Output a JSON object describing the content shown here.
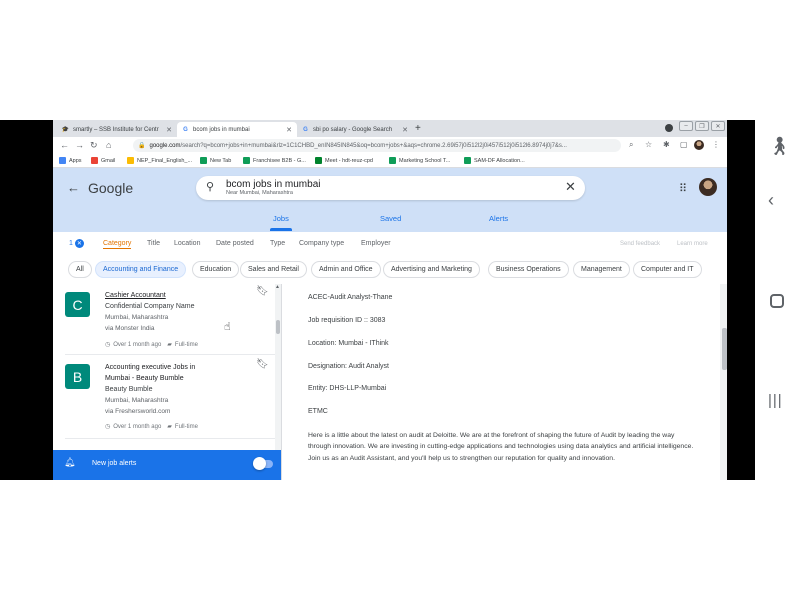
{
  "browser": {
    "tabs": [
      {
        "label": "smartly – SSB Institute for Centr",
        "icon": "graduation-cap-icon"
      },
      {
        "label": "bcom jobs in mumbai",
        "icon": "google-icon"
      },
      {
        "label": "sbi po salary - Google Search",
        "icon": "google-icon"
      }
    ],
    "new_tab_symbol": "+",
    "url_host": "google.com",
    "url_path": "/search?q=bcom+jobs+in+mumbai&rlz=1C1CHBD_enIN845IN845&oq=bcom+jobs+&aqs=chrome.2.69i57j0i512l2j0i457i512j0i512l6.8974j0j7&s...",
    "bookmarks": [
      {
        "label": "Apps",
        "color": "#4285f4"
      },
      {
        "label": "Gmail",
        "color": "#ea4335"
      },
      {
        "label": "NEP_Final_English_...",
        "color": "#fbbc04"
      },
      {
        "label": "New Tab",
        "color": "#0f9d58"
      },
      {
        "label": "Franchisee B2B - G...",
        "color": "#0f9d58"
      },
      {
        "label": "Meet - hdt-reuz-cpd",
        "color": "#00832d"
      },
      {
        "label": "Marketing School T...",
        "color": "#0f9d58"
      },
      {
        "label": "SAM-DF Allocation...",
        "color": "#0f9d58"
      }
    ]
  },
  "google": {
    "logo": "Google",
    "query": "bcom jobs in mumbai",
    "location": "Near Mumbai, Maharashtra",
    "tabs": [
      "Jobs",
      "Saved",
      "Alerts"
    ],
    "accent": "#1a73e8"
  },
  "filters": {
    "count": "1",
    "items": [
      "Category",
      "Title",
      "Location",
      "Date posted",
      "Type",
      "Company type",
      "Employer"
    ],
    "send_feedback": "Send feedback",
    "learn_more": "Learn more"
  },
  "chips": [
    "All",
    "Accounting and Finance",
    "Education",
    "Sales and Retail",
    "Admin and Office",
    "Advertising and Marketing",
    "Business Operations",
    "Management",
    "Computer and IT"
  ],
  "results": [
    {
      "logo_letter": "C",
      "title": "Cashier Accountant",
      "company": "Confidential Company Name",
      "location": "Mumbai, Maharashtra",
      "via": "via Monster India",
      "posted": "Over 1 month ago",
      "type": "Full-time"
    },
    {
      "logo_letter": "B",
      "title_lines": [
        "Accounting executive Jobs in",
        "Mumbai - Beauty Bumble"
      ],
      "company": "Beauty Bumble",
      "location": "Mumbai, Maharashtra",
      "via": "via Freshersworld.com",
      "posted": "Over 1 month ago",
      "type": "Full-time"
    }
  ],
  "alerts": {
    "label": "New job alerts"
  },
  "detail": {
    "lines": [
      "ACEC-Audit Analyst-Thane",
      "Job requisition ID :: 3083",
      "Location: Mumbai - IThink",
      "Designation: Audit Analyst",
      "Entity: DHS-LLP-Mumbai",
      "ETMC"
    ],
    "paragraph": "Here is a little about the latest on audit at Deloitte. We are at the forefront of shaping the future of Audit by leading the way through innovation. We are investing in cutting-edge applications and technologies using data analytics and artificial intelligence. Join us as an Audit Assistant, and you'll help us to strengthen our reputation for quality and innovation."
  }
}
